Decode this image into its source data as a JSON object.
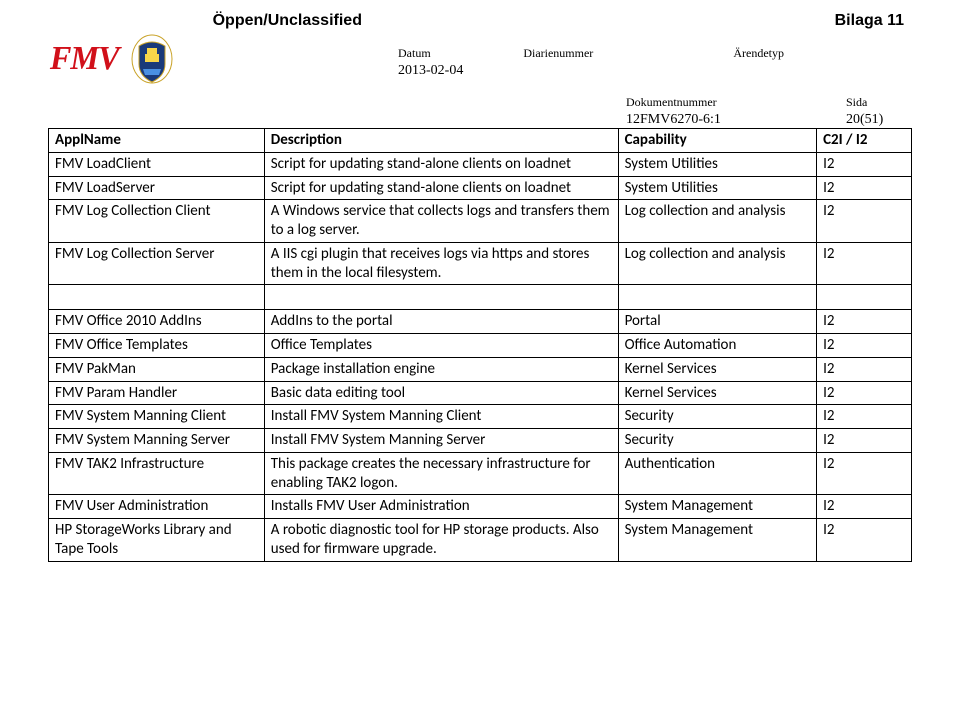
{
  "header": {
    "classification": "Öppen/Unclassified",
    "bilaga": "Bilaga 11",
    "logo_text": "FMV",
    "meta1": {
      "datum_label": "Datum",
      "datum_value": "2013-02-04",
      "diarie_label": "Diarienummer",
      "arende_label": "Ärendetyp"
    },
    "meta2": {
      "dok_label": "Dokumentnummer",
      "dok_value": "12FMV6270-6:1",
      "sida_label": "Sida",
      "sida_value": "20(51)"
    }
  },
  "table": {
    "headers": [
      "ApplName",
      "Description",
      "Capability",
      "C2I / I2"
    ],
    "group1": [
      {
        "name": "FMV LoadClient",
        "desc": "Script for updating stand-alone clients on loadnet",
        "cap": "System Utilities",
        "lvl": "I2"
      },
      {
        "name": "FMV LoadServer",
        "desc": "Script for updating stand-alone clients on loadnet",
        "cap": "System Utilities",
        "lvl": "I2"
      },
      {
        "name": "FMV Log Collection Client",
        "desc": "A Windows service that collects logs and transfers them to a log server.",
        "cap": "Log collection and analysis",
        "lvl": "I2"
      },
      {
        "name": "FMV Log Collection Server",
        "desc": "A IIS cgi plugin that receives logs via https and stores them in the local filesystem.",
        "cap": "Log collection and analysis",
        "lvl": "I2"
      }
    ],
    "group2": [
      {
        "name": "FMV Office 2010 AddIns",
        "desc": "AddIns to the portal",
        "cap": "Portal",
        "lvl": "I2"
      },
      {
        "name": "FMV Office Templates",
        "desc": "Office Templates",
        "cap": "Office Automation",
        "lvl": "I2"
      },
      {
        "name": "FMV PakMan",
        "desc": "Package installation engine",
        "cap": "Kernel Services",
        "lvl": "I2"
      },
      {
        "name": "FMV Param Handler",
        "desc": "Basic data editing tool",
        "cap": "Kernel Services",
        "lvl": "I2"
      },
      {
        "name": "FMV System Manning Client",
        "desc": "Install FMV System Manning Client",
        "cap": "Security",
        "lvl": "I2"
      },
      {
        "name": "FMV System Manning Server",
        "desc": "Install FMV System Manning Server",
        "cap": "Security",
        "lvl": "I2"
      },
      {
        "name": "FMV TAK2 Infrastructure",
        "desc": "This package creates the necessary infrastructure for enabling TAK2 logon.",
        "cap": "Authentication",
        "lvl": "I2"
      },
      {
        "name": "FMV User Administration",
        "desc": "Installs FMV User Administration",
        "cap": "System Management",
        "lvl": "I2"
      },
      {
        "name": "HP StorageWorks Library and Tape Tools",
        "desc": "A robotic diagnostic tool for HP storage products. Also used for firmware upgrade.",
        "cap": "System Management",
        "lvl": "I2"
      }
    ]
  }
}
